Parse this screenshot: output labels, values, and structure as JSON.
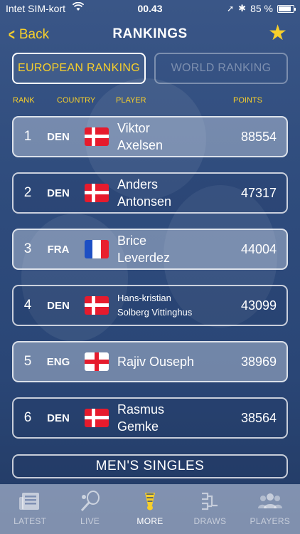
{
  "status": {
    "carrier": "Intet SIM-kort",
    "time": "00.43",
    "battery": "85 %",
    "battery_level": 0.85
  },
  "nav": {
    "back_label": "Back",
    "title": "RANKINGS"
  },
  "segments": {
    "european": "EUROPEAN RANKING",
    "world": "WORLD RANKING",
    "selected": "european"
  },
  "columns": {
    "rank": "RANK",
    "country": "COUNTRY",
    "player": "PLAYER",
    "points": "POINTS"
  },
  "rankings": [
    {
      "rank": "1",
      "country": "DEN",
      "flag": "den",
      "first": "Viktor",
      "last": "Axelsen",
      "points": "88554"
    },
    {
      "rank": "2",
      "country": "DEN",
      "flag": "den",
      "first": "Anders",
      "last": "Antonsen",
      "points": "47317"
    },
    {
      "rank": "3",
      "country": "FRA",
      "flag": "fra",
      "first": "Brice",
      "last": "Leverdez",
      "points": "44004"
    },
    {
      "rank": "4",
      "country": "DEN",
      "flag": "den",
      "first": "Hans-kristian",
      "last": "Solberg Vittinghus",
      "points": "43099"
    },
    {
      "rank": "5",
      "country": "ENG",
      "flag": "eng",
      "first": "Rajiv Ouseph",
      "last": "",
      "points": "38969"
    },
    {
      "rank": "6",
      "country": "DEN",
      "flag": "den",
      "first": "Rasmus",
      "last": "Gemke",
      "points": "38564"
    }
  ],
  "category": "MEN'S SINGLES",
  "tabs": [
    {
      "label": "LATEST",
      "icon": "newspaper-icon"
    },
    {
      "label": "LIVE",
      "icon": "racket-icon"
    },
    {
      "label": "MORE",
      "icon": "shuttlecock-icon"
    },
    {
      "label": "DRAWS",
      "icon": "bracket-icon"
    },
    {
      "label": "PLAYERS",
      "icon": "players-icon"
    }
  ],
  "colors": {
    "accent": "#f7cf2b",
    "background": "#2f4c7d"
  }
}
